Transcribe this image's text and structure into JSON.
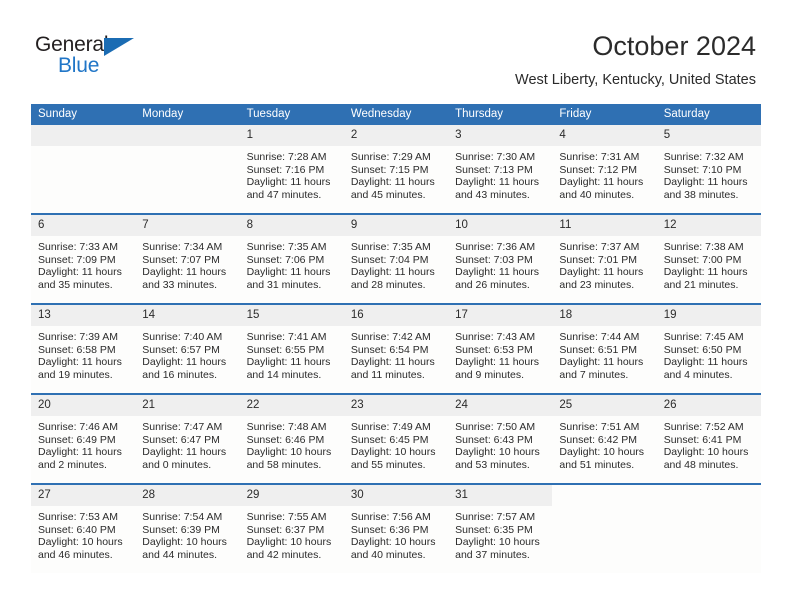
{
  "brand": {
    "name_top": "General",
    "name_bottom": "Blue"
  },
  "header": {
    "title": "October 2024",
    "location": "West Liberty, Kentucky, United States"
  },
  "calendar": {
    "weekdays": [
      "Sunday",
      "Monday",
      "Tuesday",
      "Wednesday",
      "Thursday",
      "Friday",
      "Saturday"
    ],
    "accent_color": "#2f70b3",
    "daynum_band_color": "#efefef",
    "cell_bg_color": "#fdfdfc",
    "weeks": [
      [
        {
          "day": "",
          "sunrise": "",
          "sunset": "",
          "daylight1": "",
          "daylight2": "",
          "blank": true
        },
        {
          "day": "",
          "sunrise": "",
          "sunset": "",
          "daylight1": "",
          "daylight2": "",
          "blank": true
        },
        {
          "day": "1",
          "sunrise": "Sunrise: 7:28 AM",
          "sunset": "Sunset: 7:16 PM",
          "daylight1": "Daylight: 11 hours",
          "daylight2": "and 47 minutes."
        },
        {
          "day": "2",
          "sunrise": "Sunrise: 7:29 AM",
          "sunset": "Sunset: 7:15 PM",
          "daylight1": "Daylight: 11 hours",
          "daylight2": "and 45 minutes."
        },
        {
          "day": "3",
          "sunrise": "Sunrise: 7:30 AM",
          "sunset": "Sunset: 7:13 PM",
          "daylight1": "Daylight: 11 hours",
          "daylight2": "and 43 minutes."
        },
        {
          "day": "4",
          "sunrise": "Sunrise: 7:31 AM",
          "sunset": "Sunset: 7:12 PM",
          "daylight1": "Daylight: 11 hours",
          "daylight2": "and 40 minutes."
        },
        {
          "day": "5",
          "sunrise": "Sunrise: 7:32 AM",
          "sunset": "Sunset: 7:10 PM",
          "daylight1": "Daylight: 11 hours",
          "daylight2": "and 38 minutes."
        }
      ],
      [
        {
          "day": "6",
          "sunrise": "Sunrise: 7:33 AM",
          "sunset": "Sunset: 7:09 PM",
          "daylight1": "Daylight: 11 hours",
          "daylight2": "and 35 minutes."
        },
        {
          "day": "7",
          "sunrise": "Sunrise: 7:34 AM",
          "sunset": "Sunset: 7:07 PM",
          "daylight1": "Daylight: 11 hours",
          "daylight2": "and 33 minutes."
        },
        {
          "day": "8",
          "sunrise": "Sunrise: 7:35 AM",
          "sunset": "Sunset: 7:06 PM",
          "daylight1": "Daylight: 11 hours",
          "daylight2": "and 31 minutes."
        },
        {
          "day": "9",
          "sunrise": "Sunrise: 7:35 AM",
          "sunset": "Sunset: 7:04 PM",
          "daylight1": "Daylight: 11 hours",
          "daylight2": "and 28 minutes."
        },
        {
          "day": "10",
          "sunrise": "Sunrise: 7:36 AM",
          "sunset": "Sunset: 7:03 PM",
          "daylight1": "Daylight: 11 hours",
          "daylight2": "and 26 minutes."
        },
        {
          "day": "11",
          "sunrise": "Sunrise: 7:37 AM",
          "sunset": "Sunset: 7:01 PM",
          "daylight1": "Daylight: 11 hours",
          "daylight2": "and 23 minutes."
        },
        {
          "day": "12",
          "sunrise": "Sunrise: 7:38 AM",
          "sunset": "Sunset: 7:00 PM",
          "daylight1": "Daylight: 11 hours",
          "daylight2": "and 21 minutes."
        }
      ],
      [
        {
          "day": "13",
          "sunrise": "Sunrise: 7:39 AM",
          "sunset": "Sunset: 6:58 PM",
          "daylight1": "Daylight: 11 hours",
          "daylight2": "and 19 minutes."
        },
        {
          "day": "14",
          "sunrise": "Sunrise: 7:40 AM",
          "sunset": "Sunset: 6:57 PM",
          "daylight1": "Daylight: 11 hours",
          "daylight2": "and 16 minutes."
        },
        {
          "day": "15",
          "sunrise": "Sunrise: 7:41 AM",
          "sunset": "Sunset: 6:55 PM",
          "daylight1": "Daylight: 11 hours",
          "daylight2": "and 14 minutes."
        },
        {
          "day": "16",
          "sunrise": "Sunrise: 7:42 AM",
          "sunset": "Sunset: 6:54 PM",
          "daylight1": "Daylight: 11 hours",
          "daylight2": "and 11 minutes."
        },
        {
          "day": "17",
          "sunrise": "Sunrise: 7:43 AM",
          "sunset": "Sunset: 6:53 PM",
          "daylight1": "Daylight: 11 hours",
          "daylight2": "and 9 minutes."
        },
        {
          "day": "18",
          "sunrise": "Sunrise: 7:44 AM",
          "sunset": "Sunset: 6:51 PM",
          "daylight1": "Daylight: 11 hours",
          "daylight2": "and 7 minutes."
        },
        {
          "day": "19",
          "sunrise": "Sunrise: 7:45 AM",
          "sunset": "Sunset: 6:50 PM",
          "daylight1": "Daylight: 11 hours",
          "daylight2": "and 4 minutes."
        }
      ],
      [
        {
          "day": "20",
          "sunrise": "Sunrise: 7:46 AM",
          "sunset": "Sunset: 6:49 PM",
          "daylight1": "Daylight: 11 hours",
          "daylight2": "and 2 minutes."
        },
        {
          "day": "21",
          "sunrise": "Sunrise: 7:47 AM",
          "sunset": "Sunset: 6:47 PM",
          "daylight1": "Daylight: 11 hours",
          "daylight2": "and 0 minutes."
        },
        {
          "day": "22",
          "sunrise": "Sunrise: 7:48 AM",
          "sunset": "Sunset: 6:46 PM",
          "daylight1": "Daylight: 10 hours",
          "daylight2": "and 58 minutes."
        },
        {
          "day": "23",
          "sunrise": "Sunrise: 7:49 AM",
          "sunset": "Sunset: 6:45 PM",
          "daylight1": "Daylight: 10 hours",
          "daylight2": "and 55 minutes."
        },
        {
          "day": "24",
          "sunrise": "Sunrise: 7:50 AM",
          "sunset": "Sunset: 6:43 PM",
          "daylight1": "Daylight: 10 hours",
          "daylight2": "and 53 minutes."
        },
        {
          "day": "25",
          "sunrise": "Sunrise: 7:51 AM",
          "sunset": "Sunset: 6:42 PM",
          "daylight1": "Daylight: 10 hours",
          "daylight2": "and 51 minutes."
        },
        {
          "day": "26",
          "sunrise": "Sunrise: 7:52 AM",
          "sunset": "Sunset: 6:41 PM",
          "daylight1": "Daylight: 10 hours",
          "daylight2": "and 48 minutes."
        }
      ],
      [
        {
          "day": "27",
          "sunrise": "Sunrise: 7:53 AM",
          "sunset": "Sunset: 6:40 PM",
          "daylight1": "Daylight: 10 hours",
          "daylight2": "and 46 minutes."
        },
        {
          "day": "28",
          "sunrise": "Sunrise: 7:54 AM",
          "sunset": "Sunset: 6:39 PM",
          "daylight1": "Daylight: 10 hours",
          "daylight2": "and 44 minutes."
        },
        {
          "day": "29",
          "sunrise": "Sunrise: 7:55 AM",
          "sunset": "Sunset: 6:37 PM",
          "daylight1": "Daylight: 10 hours",
          "daylight2": "and 42 minutes."
        },
        {
          "day": "30",
          "sunrise": "Sunrise: 7:56 AM",
          "sunset": "Sunset: 6:36 PM",
          "daylight1": "Daylight: 10 hours",
          "daylight2": "and 40 minutes."
        },
        {
          "day": "31",
          "sunrise": "Sunrise: 7:57 AM",
          "sunset": "Sunset: 6:35 PM",
          "daylight1": "Daylight: 10 hours",
          "daylight2": "and 37 minutes."
        },
        {
          "day": "",
          "sunrise": "",
          "sunset": "",
          "daylight1": "",
          "daylight2": "",
          "void": true
        },
        {
          "day": "",
          "sunrise": "",
          "sunset": "",
          "daylight1": "",
          "daylight2": "",
          "void": true
        }
      ]
    ]
  }
}
